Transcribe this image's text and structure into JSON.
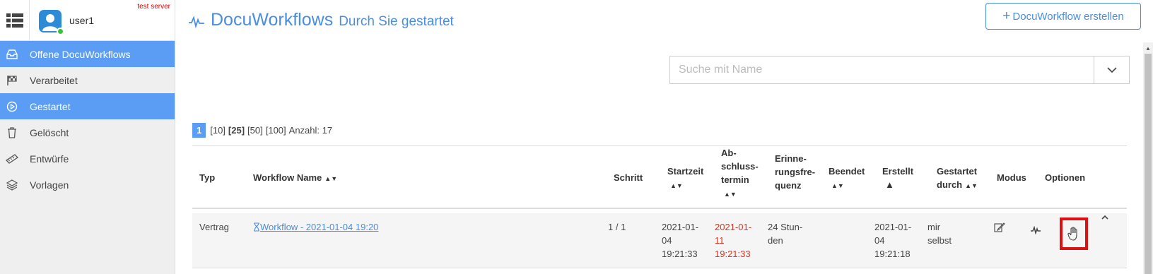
{
  "header": {
    "user_name": "user1",
    "test_server_label": "test server",
    "title": "DocuWorkflows",
    "subtitle": "Durch Sie gestartet",
    "create_button_label": "DocuWorkflow erstellen"
  },
  "sidebar": {
    "items": [
      {
        "label": "Offene DocuWorkflows",
        "icon": "inbox-icon",
        "active": true
      },
      {
        "label": "Verarbeitet",
        "icon": "checkered-flag-icon",
        "active": false
      },
      {
        "label": "Gestartet",
        "icon": "play-circle-icon",
        "active": true
      },
      {
        "label": "Gelöscht",
        "icon": "trash-icon",
        "active": false
      },
      {
        "label": "Entwürfe",
        "icon": "ruler-icon",
        "active": false
      },
      {
        "label": "Vorlagen",
        "icon": "layers-icon",
        "active": false
      }
    ]
  },
  "search": {
    "placeholder": "Suche mit Name"
  },
  "pager": {
    "current_page": "1",
    "size_10": "[10]",
    "size_25": "[25]",
    "size_50": "[50]",
    "size_100": "[100]",
    "count_label": "Anzahl: 17"
  },
  "table": {
    "columns": {
      "typ": "Typ",
      "name": "Workflow Name",
      "schritt": "Schritt",
      "startzeit": "Startzeit",
      "abschluss_1": "Ab-",
      "abschluss_2": "schluss-",
      "abschluss_3": "termin",
      "erinnerung_1": "Erinne-",
      "erinnerung_2": "rungsfre-",
      "erinnerung_3": "quenz",
      "beendet": "Beendet",
      "erstellt": "Erstellt",
      "gestartet_1": "Gestartet",
      "gestartet_2": "durch",
      "modus": "Modus",
      "optionen": "Optionen"
    },
    "rows": [
      {
        "typ": "Vertrag",
        "name": "Workflow - 2021-01-04 19:20",
        "schritt": "1 / 1",
        "start_1": "2021-01-",
        "start_2": "04",
        "start_3": "19:21:33",
        "abschluss_1": "2021-01-",
        "abschluss_2": "11",
        "abschluss_3": "19:21:33",
        "erinnerung_1": "24 Stun-",
        "erinnerung_2": "den",
        "beendet": "",
        "erstellt_1": "2021-01-",
        "erstellt_2": "04",
        "erstellt_3": "19:21:18",
        "gestartet_1": "mir",
        "gestartet_2": "selbst"
      }
    ]
  },
  "colors": {
    "accent": "#5b9cf4",
    "link": "#4a8ee0",
    "danger": "#d9341f",
    "highlight_box": "#dd1111"
  }
}
